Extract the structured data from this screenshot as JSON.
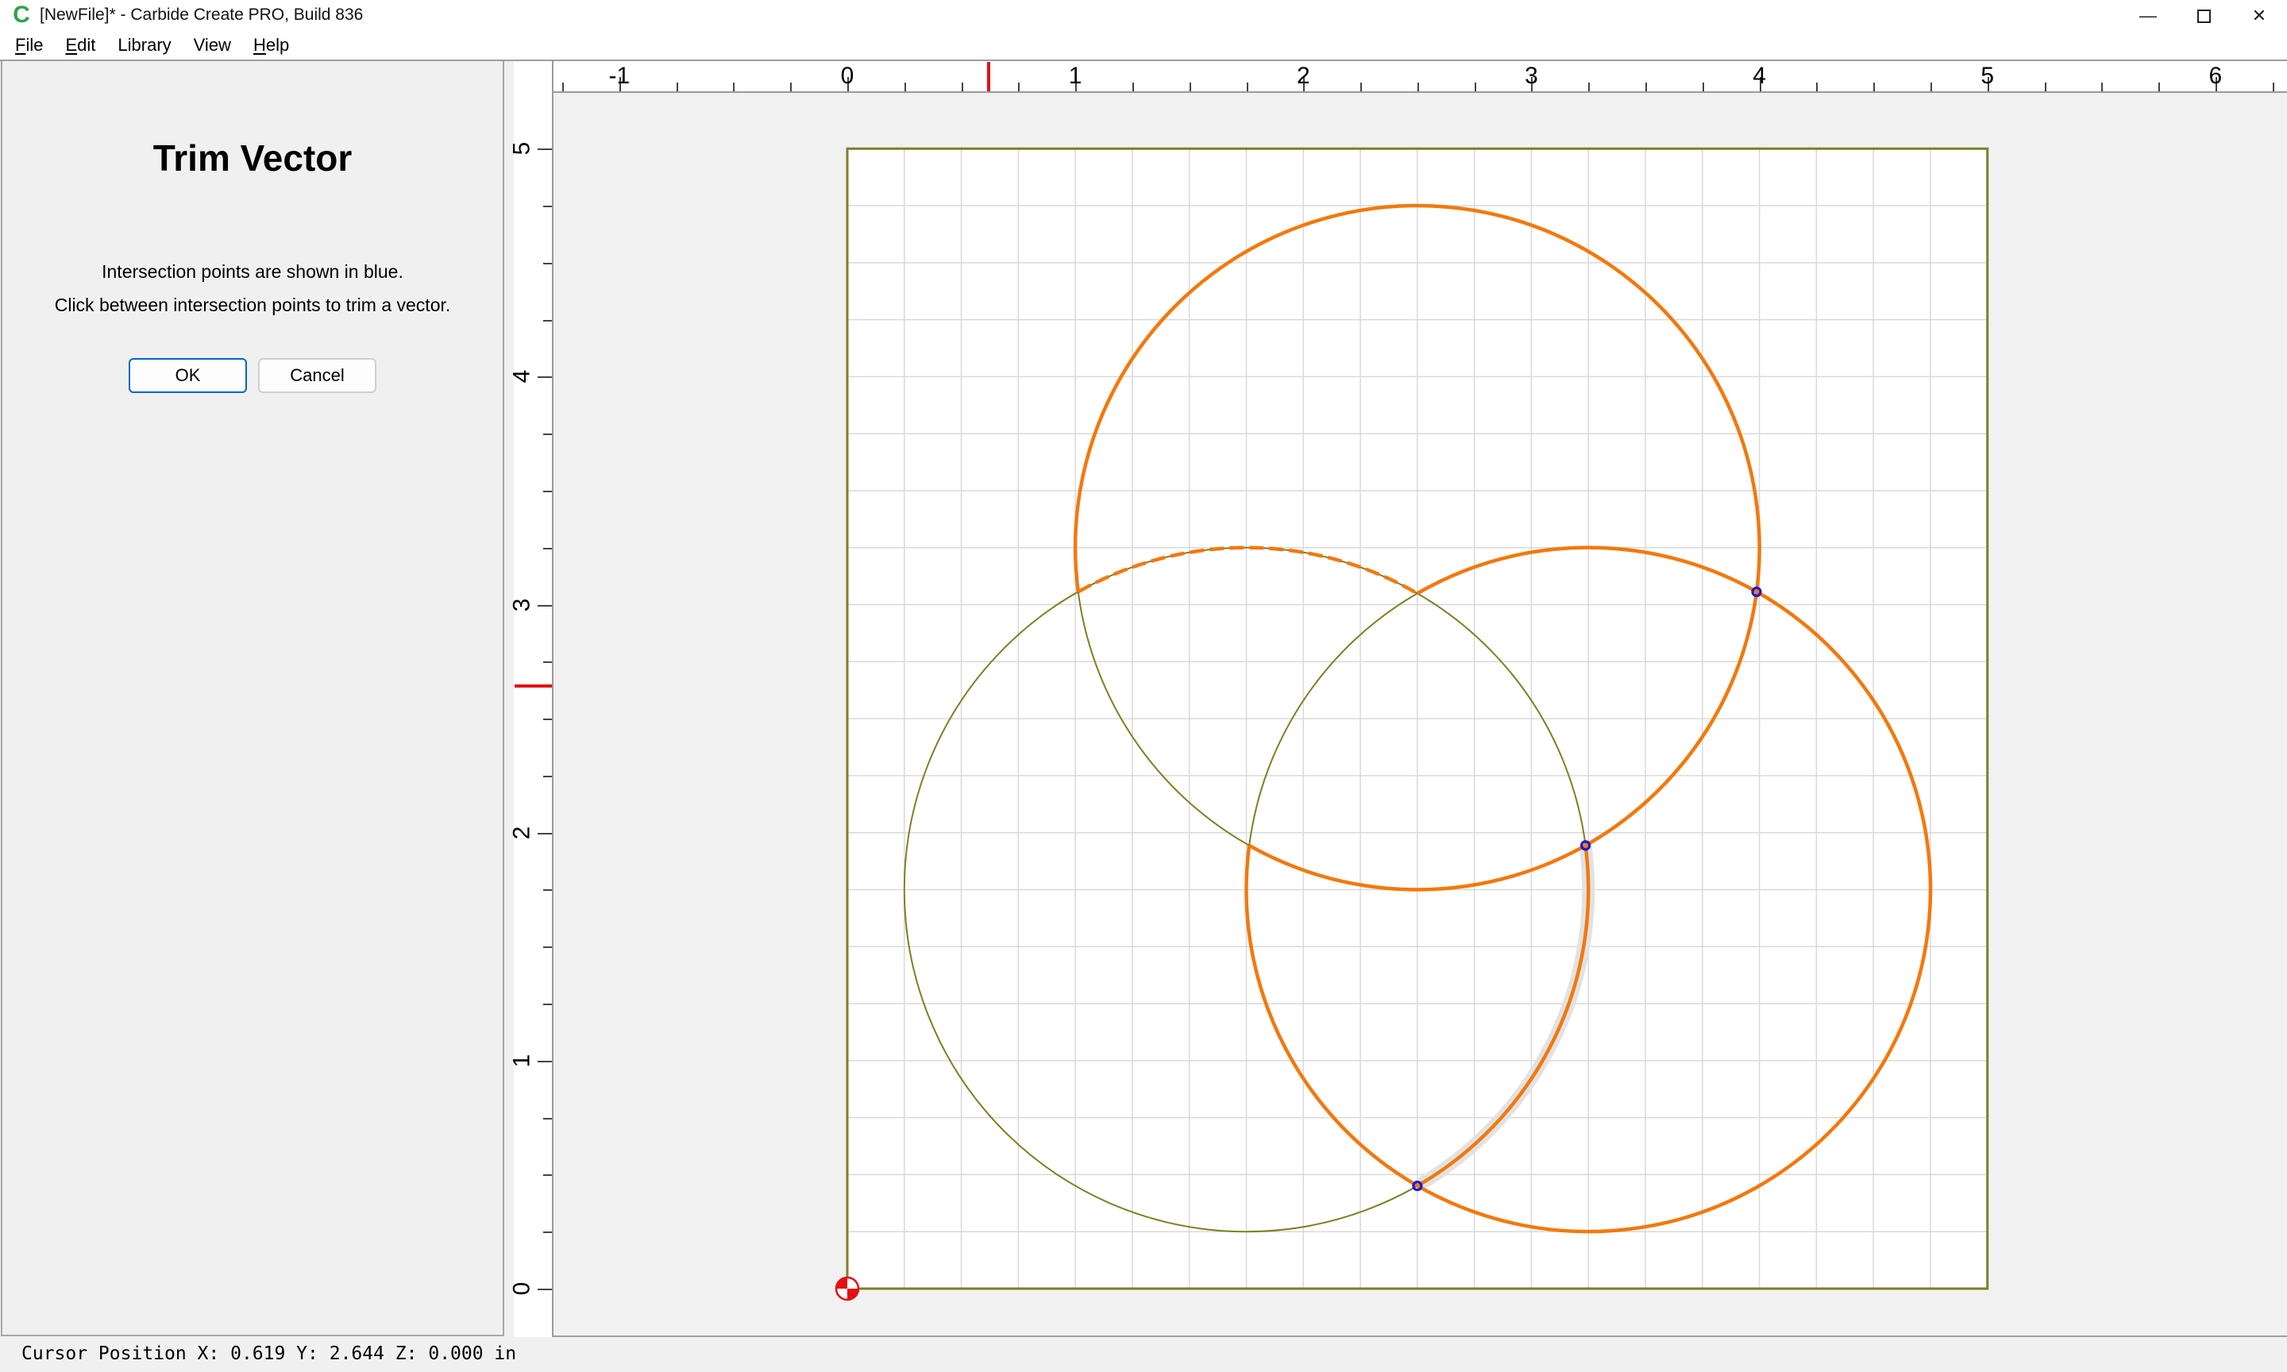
{
  "window": {
    "title": "[NewFile]* - Carbide Create PRO, Build 836",
    "icon": "carbide-create-logo",
    "buttons": {
      "minimize": "—",
      "restore": "restore",
      "close": "✕"
    }
  },
  "menu": {
    "items": [
      {
        "label": "File",
        "underline": 0
      },
      {
        "label": "Edit",
        "underline": 0
      },
      {
        "label": "Library",
        "underline": -1
      },
      {
        "label": "View",
        "underline": -1
      },
      {
        "label": "Help",
        "underline": 0
      }
    ]
  },
  "panel": {
    "title": "Trim Vector",
    "instruction1": "Intersection points are shown in blue.",
    "instruction2": "Click between intersection points to trim a vector.",
    "ok_label": "OK",
    "cancel_label": "Cancel"
  },
  "status": {
    "text": "Cursor Position X: 0.619 Y: 2.644 Z: 0.000 in"
  },
  "rulers": {
    "top_labels": [
      -1,
      0,
      1,
      2,
      3,
      4,
      5,
      6
    ],
    "left_labels": [
      0,
      1,
      2,
      3,
      4,
      5
    ],
    "units": "in",
    "cursor_x_in": 0.619,
    "cursor_y_in": 2.644
  },
  "canvas": {
    "stock": {
      "width_in": 5,
      "height_in": 5,
      "origin_in": [
        0,
        0
      ]
    },
    "colors": {
      "orange": "#f2790d",
      "olive": "#7f7f23",
      "stock_border": "#7e7e2b",
      "grid": "#d9d9d9",
      "blue": "#1a1ad2",
      "red": "#e11212",
      "halo": "#e2e2e2",
      "stock_fill": "#ffffff"
    },
    "circle_radius_in": 1.5,
    "circle_centers_in": [
      [
        2.5,
        3.25
      ],
      [
        3.25,
        1.75
      ],
      [
        1.75,
        1.75
      ]
    ],
    "arcs": [
      {
        "type": "circle",
        "cx": 1.75,
        "cy": 1.75,
        "style": "olive"
      },
      {
        "type": "arc",
        "from": [
          1.0126,
          3.0562
        ],
        "to": [
          1.7626,
          1.9438
        ],
        "large": 0,
        "sweep": 0,
        "style": "olive"
      },
      {
        "type": "arc",
        "from": [
          1.7626,
          1.9438
        ],
        "to": [
          2.5,
          3.0494
        ],
        "large": 0,
        "sweep": 1,
        "style": "olive"
      },
      {
        "type": "arc",
        "from": [
          3.2374,
          1.9438
        ],
        "to": [
          2.5,
          0.4507
        ],
        "large": 0,
        "sweep": 1,
        "style": "halo"
      },
      {
        "type": "arc",
        "from": [
          1.7626,
          1.9438
        ],
        "to": [
          1.0126,
          3.0562
        ],
        "large": 1,
        "sweep": 0,
        "style": "orange"
      },
      {
        "type": "arc",
        "from": [
          2.5,
          3.0494
        ],
        "to": [
          1.7626,
          1.9438
        ],
        "large": 1,
        "sweep": 1,
        "style": "orange"
      },
      {
        "type": "arc",
        "from": [
          3.2374,
          1.9438
        ],
        "to": [
          2.5,
          0.4507
        ],
        "large": 0,
        "sweep": 1,
        "style": "orange"
      },
      {
        "type": "arc",
        "from": [
          1.0126,
          3.0562
        ],
        "to": [
          2.5,
          3.0494
        ],
        "large": 0,
        "sweep": 1,
        "style": "orange-dash"
      }
    ],
    "intersection_markers_in": [
      [
        3.9874,
        3.0562
      ],
      [
        3.2374,
        1.9438
      ],
      [
        2.5,
        0.4507
      ]
    ]
  }
}
